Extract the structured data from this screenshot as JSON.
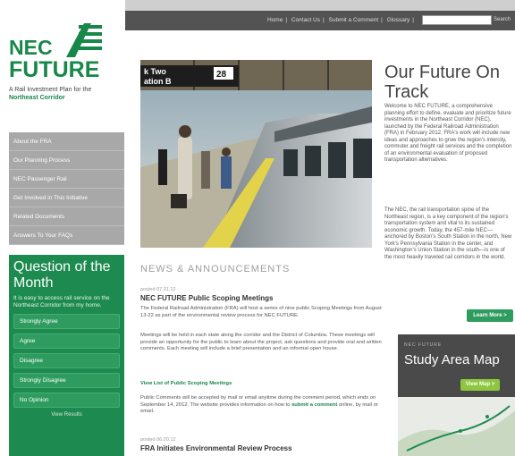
{
  "logo": {
    "line1": "NEC",
    "line2": "FUTURE",
    "tagline_start": "A Rail Investment Plan for the ",
    "tagline_bold": "Northeast Corridor"
  },
  "nav": {
    "items": [
      "About the FRA",
      "Our Planning Process",
      "NEC Passenger Rail",
      "Get Involved in This Initiative",
      "Related Documents",
      "Answers To Your FAQs"
    ]
  },
  "question": {
    "heading": "Question of the Month",
    "text": "It is easy to access rail service on the Northeast Corridor from my home.",
    "options": [
      "Strongly Agree",
      "Agree",
      "Disagree",
      "Strongly Disagree",
      "No Opinion"
    ],
    "view_results": "View Results"
  },
  "topbar": {
    "links": [
      "Home",
      "Contact Us",
      "Submit a Comment",
      "Glossary"
    ],
    "search_label": "Search"
  },
  "hero": {
    "sign_text": "k Two",
    "sign_text2": "ation B",
    "sign_number": "28"
  },
  "intro": {
    "title": "Our Future On Track",
    "para1": "Welcome to NEC FUTURE, a comprehensive planning effort to define, evaluate and prioritize future investments in the Northeast Corridor (NEC), launched by the Federal Railroad Administration (FRA) in February 2012. FRA's work will include new ideas and approaches to grow the region's intercity, commuter and freight rail services and the completion of an environmental evaluation of proposed transportation alternatives.",
    "para2": "The NEC, the rail transportation spine of the Northeast region, is a key component of the region's transportation system and vital to its sustained economic growth. Today, the 457-mile NEC—anchored by Boston's South Station in the north, New York's Pennsylvania Station in the center, and Washington's Union Station in the south—is one of the most heavily traveled rail corridors in the world.",
    "learn_more": "Learn More >"
  },
  "study": {
    "kicker": "NEC FUTURE",
    "title": "Study Area Map",
    "button": "View Map >"
  },
  "news": {
    "heading": "NEWS & ANNOUNCEMENTS",
    "item1_date": "posted 07.31.12",
    "item1_title": "NEC FUTURE Public Scoping Meetings",
    "item1_p1": "The Federal Railroad Administration (FRA) will host a series of nine public Scoping Meetings from August 13-22 as part of the environmental review process for NEC FUTURE.",
    "item1_p2": "Meetings will be held in each state along the corridor and the District of Columbia. These meetings will provide an opportunity for the public to learn about the project, ask questions and provide oral and written comments. Each meeting will include a brief presentation and an informal open house.",
    "item1_link": "View List of Public Scoping Meetings",
    "item1_p3_start": "Public Comments will be accepted by mail or email anytime during the comment period, which ends on September 14, 2012. The website provides information on how to ",
    "item1_p3_link": "submit a comment",
    "item1_p3_end": " online, by mail or email.",
    "item2_date": "posted 06.20.12",
    "item2_title": "FRA Initiates Environmental Review Process"
  },
  "colors": {
    "brand_green": "#17874a",
    "nav_gray": "#a8a8a8",
    "topbar": "#535353"
  }
}
